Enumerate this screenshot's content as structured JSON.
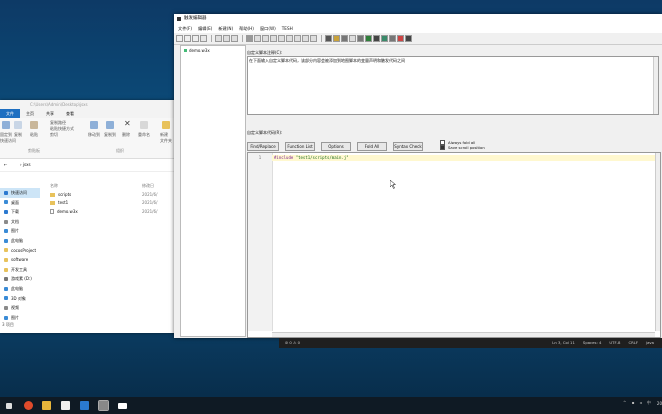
{
  "explorer": {
    "path": "C:\\Users\\Admin\\Desktop\\jsxs",
    "tabs": [
      "文件",
      "主页",
      "共享",
      "查看"
    ],
    "ribbon": {
      "pin": "固定到\n快速访问",
      "copy": "复制",
      "paste": "粘贴",
      "copy_path": "复制路径",
      "paste_shortcut": "粘贴快捷方式",
      "cut": "剪切",
      "clipboard_group": "剪贴板",
      "move_to": "移动到",
      "copy_to": "复制到",
      "delete": "删除",
      "rename": "重命名",
      "organize_group": "组织",
      "new_folder": "新建\n文件夹"
    },
    "breadcrumb": "jsxs",
    "nav": [
      {
        "label": "快速访问",
        "color": "#2b79d0",
        "selected": true
      },
      {
        "label": "桌面",
        "color": "#3a8bd6"
      },
      {
        "label": "下载",
        "color": "#2b79d0"
      },
      {
        "label": "文档",
        "color": "#8a8a8a"
      },
      {
        "label": "图片",
        "color": "#3a8bd6"
      },
      {
        "label": "此电脑",
        "color": "#3a8bd6"
      },
      {
        "label": "cocosProject",
        "color": "#e8c25b"
      },
      {
        "label": "software",
        "color": "#e8c25b"
      },
      {
        "label": "开发工具",
        "color": "#e8c25b"
      },
      {
        "label": "游戏素 (D:)",
        "color": "#777"
      },
      {
        "label": "此电脑",
        "color": "#3a8bd6"
      },
      {
        "label": "3D 对象",
        "color": "#3a8bd6"
      },
      {
        "label": "视频",
        "color": "#8a8a8a"
      },
      {
        "label": "图片",
        "color": "#3a8bd6"
      }
    ],
    "columns": {
      "name": "名称",
      "date": "修改日"
    },
    "files": [
      {
        "name": "scripts",
        "date": "2021/6/",
        "type": "folder"
      },
      {
        "name": "test1",
        "date": "2021/6/",
        "type": "folder"
      },
      {
        "name": "demo.w3x",
        "date": "2021/6/",
        "type": "file"
      }
    ],
    "status": "3 项目"
  },
  "editor": {
    "title": "触发编辑器",
    "menu": [
      "文件(F)",
      "编辑(E)",
      "新建(N)",
      "帮助(H)",
      "窗口(W)",
      "TESH"
    ],
    "tree_item": "demo.w3x",
    "intro_label": "自定义脚本注释(C):",
    "intro_text": "在下面输入自定义脚本代码，该部分内容会被添加到地图脚本的变量声明和触发代码之间",
    "code_label": "自定义脚本代码(R):",
    "buttons": [
      "Find/Replace",
      "Function List",
      "Options",
      "Fold All",
      "Syntax Check"
    ],
    "checks": [
      {
        "label": "Always fold all",
        "checked": false
      },
      {
        "label": "Save scroll position",
        "checked": true
      }
    ],
    "code": {
      "line_number": "1",
      "directive": "#include",
      "string": "\"test1/scripts/main.j\""
    }
  },
  "statusbar": {
    "left": "⊘ 0  ⚠ 0",
    "items": [
      "Ln 3, Col 11",
      "Spaces: 4",
      "UTF-8",
      "CRLF",
      "java"
    ]
  },
  "taskbar": {
    "clock": "20"
  }
}
